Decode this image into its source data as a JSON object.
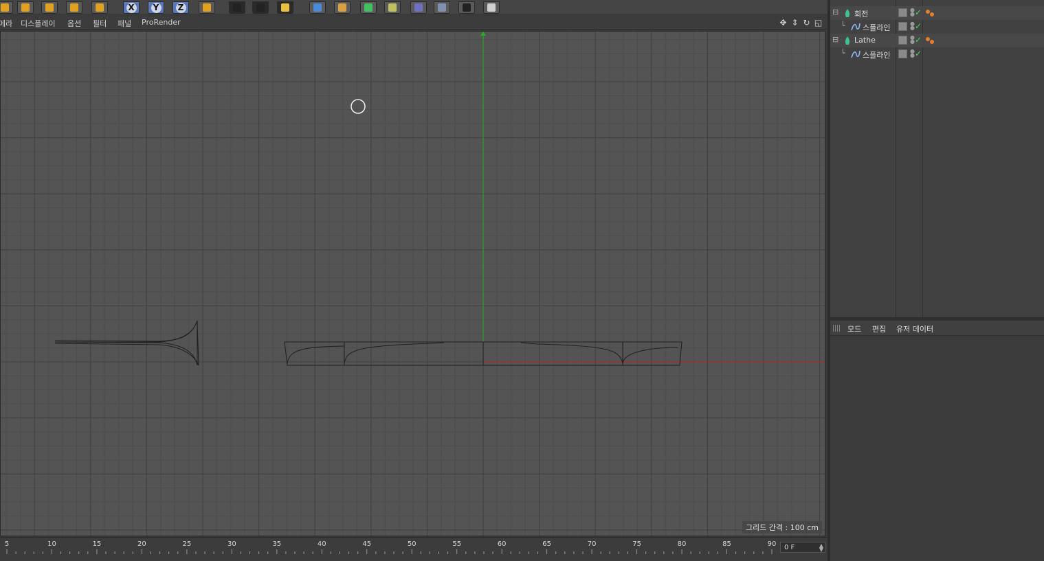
{
  "toolbar": {
    "buttons": [
      {
        "name": "rotate-partial-icon",
        "color": "#e0a020"
      },
      {
        "name": "move-icon",
        "color": "#e0a020"
      },
      {
        "name": "scale-icon",
        "color": "#e0a020"
      },
      {
        "name": "rotate-icon",
        "color": "#e0a020"
      },
      {
        "name": "live-selection-icon",
        "color": "#e0a020"
      },
      {
        "name": "lock-x-icon",
        "label": "X",
        "color": "#4a6aa8"
      },
      {
        "name": "lock-y-icon",
        "label": "Y",
        "color": "#4a6aa8"
      },
      {
        "name": "lock-z-icon",
        "label": "Z",
        "color": "#4a6aa8"
      },
      {
        "name": "coordinate-system-icon",
        "color": "#e0a020"
      },
      {
        "name": "render-view-icon",
        "color": "#222"
      },
      {
        "name": "render-picture-viewer-icon",
        "color": "#222"
      },
      {
        "name": "render-settings-icon",
        "color": "#e8c040"
      },
      {
        "name": "cube-primitive-icon",
        "color": "#4a8ad8"
      },
      {
        "name": "spline-pen-icon",
        "color": "#d8a040"
      },
      {
        "name": "subdivision-icon",
        "color": "#40c060"
      },
      {
        "name": "array-generator-icon",
        "color": "#c0c060"
      },
      {
        "name": "deformer-icon",
        "color": "#7070c0"
      },
      {
        "name": "floor-icon",
        "color": "#8090b0"
      },
      {
        "name": "camera-icon",
        "color": "#222"
      },
      {
        "name": "light-icon",
        "color": "#d0d0d0"
      }
    ]
  },
  "viewport_menu": {
    "items": [
      "메라",
      "디스플레이",
      "옵션",
      "필터",
      "패널",
      "ProRender"
    ]
  },
  "viewport": {
    "grid_spacing_label": "그리드 간격 : 100 cm",
    "axis_colors": {
      "y": "#22b022",
      "x": "#c02020"
    }
  },
  "timeline": {
    "ticks": [
      "5",
      "10",
      "15",
      "20",
      "25",
      "30",
      "35",
      "40",
      "45",
      "50",
      "55",
      "60",
      "65",
      "70",
      "75",
      "80",
      "85",
      "90"
    ],
    "current_frame": "0 F"
  },
  "object_manager": {
    "objects": [
      {
        "name": "회전",
        "type": "lathe",
        "level": 0
      },
      {
        "name": "스플라인",
        "type": "spline",
        "level": 1
      },
      {
        "name": "Lathe",
        "type": "lathe",
        "level": 0
      },
      {
        "name": "스플라인",
        "type": "spline",
        "level": 1
      }
    ]
  },
  "attributes": {
    "menu": [
      "모드",
      "편집",
      "유저 데이터"
    ]
  }
}
